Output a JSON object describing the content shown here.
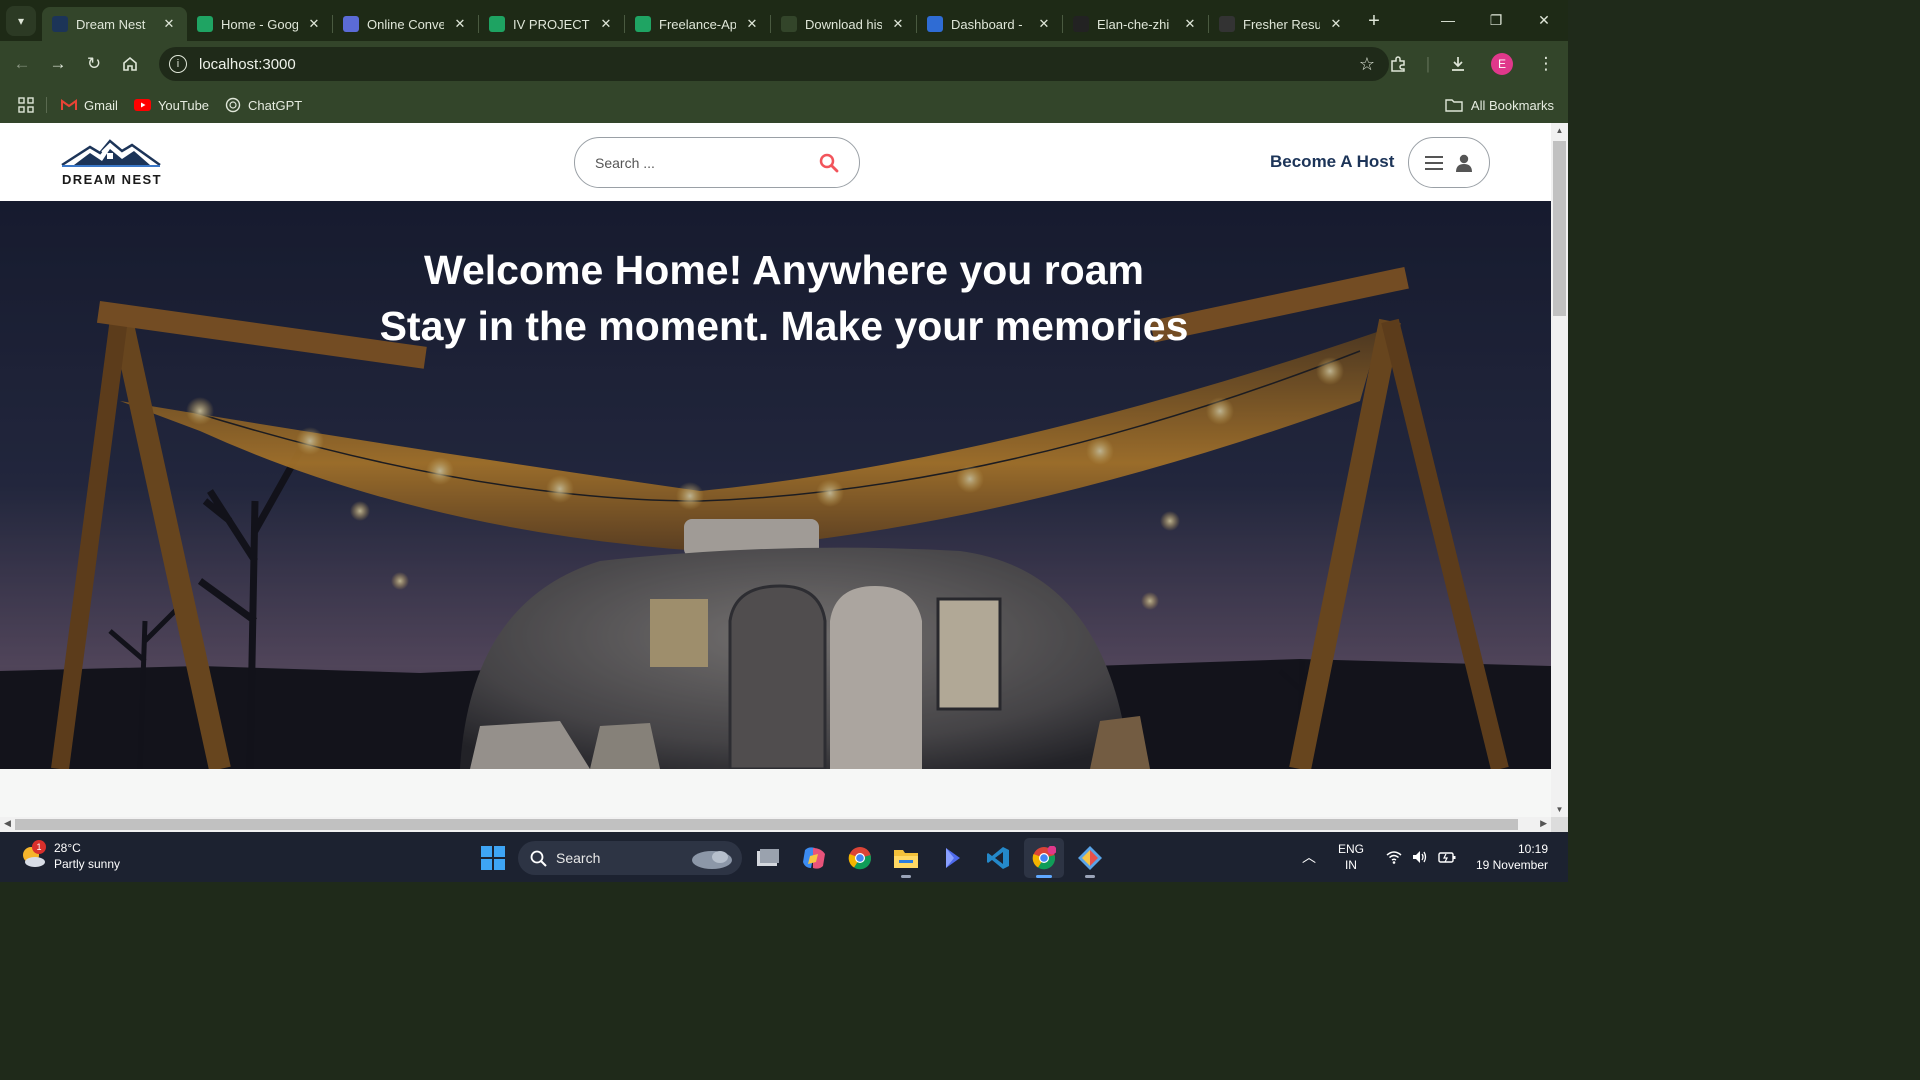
{
  "browser": {
    "tabs": [
      {
        "title": "Dream Nest",
        "active": true,
        "favicon_color": "#1c3458"
      },
      {
        "title": "Home - Goog",
        "active": false,
        "favicon_color": "#1fa463"
      },
      {
        "title": "Online Conve",
        "active": false,
        "favicon_color": "#5b6bd6"
      },
      {
        "title": "IV PROJECT N",
        "active": false,
        "favicon_color": "#1ea362"
      },
      {
        "title": "Freelance-Ap",
        "active": false,
        "favicon_color": "#1fa463"
      },
      {
        "title": "Download his",
        "active": false,
        "favicon_color": "#33452a"
      },
      {
        "title": "Dashboard -",
        "active": false,
        "favicon_color": "#2f6cd4"
      },
      {
        "title": "Elan-che-zhi",
        "active": false,
        "favicon_color": "#222222"
      },
      {
        "title": "Fresher Resu",
        "active": false,
        "favicon_color": "#333333"
      }
    ],
    "close_glyph": "✕",
    "new_tab_glyph": "+",
    "address": "localhost:3000",
    "profile_initial": "E",
    "bookmarks": [
      {
        "label": "Gmail",
        "icon": "gmail-icon"
      },
      {
        "label": "YouTube",
        "icon": "youtube-icon"
      },
      {
        "label": "ChatGPT",
        "icon": "chatgpt-icon"
      }
    ],
    "all_bookmarks_label": "All Bookmarks"
  },
  "site": {
    "logo_text": "DREAM NEST",
    "search_placeholder": "Search ...",
    "become_host_label": "Become A Host",
    "hero_line1": "Welcome Home! Anywhere you roam",
    "hero_line2": "Stay in the moment. Make your memories",
    "brand_color": "#1c3458",
    "accent_color": "#f2545b"
  },
  "taskbar": {
    "weather_badge": "1",
    "temperature": "28°C",
    "weather_desc": "Partly sunny",
    "search_label": "Search",
    "lang_top": "ENG",
    "lang_bottom": "IN",
    "time": "10:19",
    "date": "19 November"
  }
}
